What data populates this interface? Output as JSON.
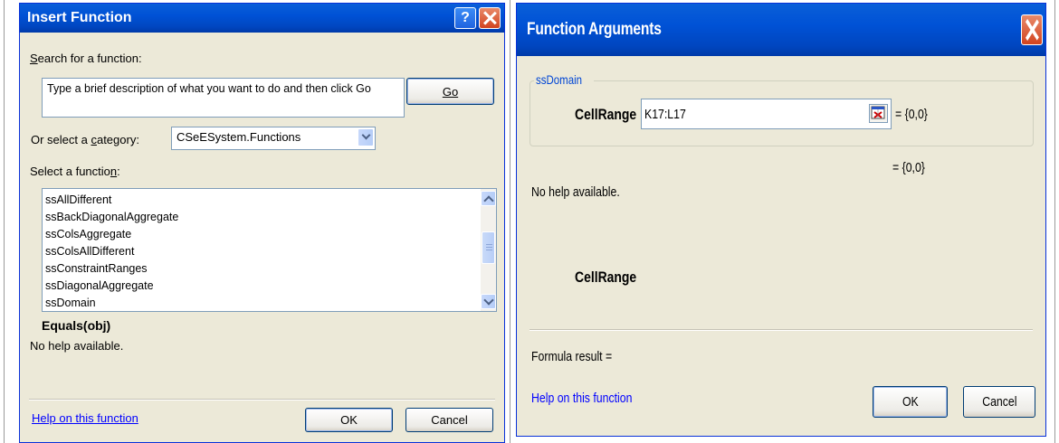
{
  "insert_function": {
    "title": "Insert Function",
    "search_label": "Search for a function:",
    "search_placeholder": "Type a brief description of what you want to do and then click Go",
    "go_button": "Go",
    "category_label": "Or select a category:",
    "category_value": "CSeESystem.Functions",
    "select_label": "Select a function:",
    "functions": [
      "ssAllDifferent",
      "ssBackDiagonalAggregate",
      "ssColsAggregate",
      "ssColsAllDifferent",
      "ssConstraintRanges",
      "ssDiagonalAggregate",
      "ssDomain"
    ],
    "signature": "Equals(obj)",
    "description": "No help available.",
    "help_link": "Help on this function",
    "ok_button": "OK",
    "cancel_button": "Cancel"
  },
  "function_arguments": {
    "title": "Function Arguments",
    "group_label": "ssDomain",
    "arg_name": "CellRange",
    "arg_value": "K17:L17",
    "arg_result": "= {0,0}",
    "function_result": "= {0,0}",
    "help_text": "No help available.",
    "arg_help_name": "CellRange",
    "formula_result_label": "Formula result =",
    "help_link": "Help on this function",
    "ok_button": "OK",
    "cancel_button": "Cancel"
  }
}
